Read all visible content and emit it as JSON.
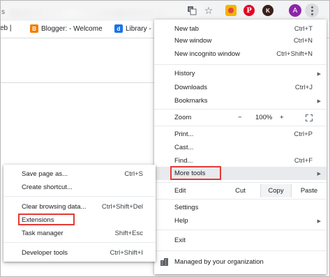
{
  "toolbar": {
    "omnibox_prefix": "s",
    "avatar_letter": "A",
    "ext_pin_letter": "P",
    "ext_k_letter": "K"
  },
  "bookmarks": [
    {
      "label": "eb |",
      "icon": "partial-favicon"
    },
    {
      "label": "Blogger: - Welcome",
      "icon": "blogger-icon"
    },
    {
      "label": "Library -",
      "icon": "library-d-icon"
    }
  ],
  "main_menu": {
    "new_tab": {
      "label": "New tab",
      "shortcut": "Ctrl+T"
    },
    "new_window": {
      "label": "New window",
      "shortcut": "Ctrl+N"
    },
    "new_incognito": {
      "label": "New incognito window",
      "shortcut": "Ctrl+Shift+N"
    },
    "history": {
      "label": "History"
    },
    "downloads": {
      "label": "Downloads",
      "shortcut": "Ctrl+J"
    },
    "bookmarks": {
      "label": "Bookmarks"
    },
    "zoom": {
      "label": "Zoom",
      "minus": "−",
      "value": "100%",
      "plus": "+"
    },
    "print": {
      "label": "Print...",
      "shortcut": "Ctrl+P"
    },
    "cast": {
      "label": "Cast..."
    },
    "find": {
      "label": "Find...",
      "shortcut": "Ctrl+F"
    },
    "more_tools": {
      "label": "More tools"
    },
    "edit": {
      "label": "Edit",
      "cut": "Cut",
      "copy": "Copy",
      "paste": "Paste"
    },
    "settings": {
      "label": "Settings"
    },
    "help": {
      "label": "Help"
    },
    "exit": {
      "label": "Exit"
    },
    "managed": {
      "label": "Managed by your organization"
    }
  },
  "sub_menu": {
    "save_page": {
      "label": "Save page as...",
      "shortcut": "Ctrl+S"
    },
    "create_shortcut": {
      "label": "Create shortcut..."
    },
    "clear_browsing": {
      "label": "Clear browsing data...",
      "shortcut": "Ctrl+Shift+Del"
    },
    "extensions": {
      "label": "Extensions"
    },
    "task_manager": {
      "label": "Task manager",
      "shortcut": "Shift+Esc"
    },
    "developer_tools": {
      "label": "Developer tools",
      "shortcut": "Ctrl+Shift+I"
    }
  },
  "colors": {
    "highlight_box": "#e53935",
    "hover_row": "#e8eaed",
    "avatar": "#8e24aa"
  }
}
